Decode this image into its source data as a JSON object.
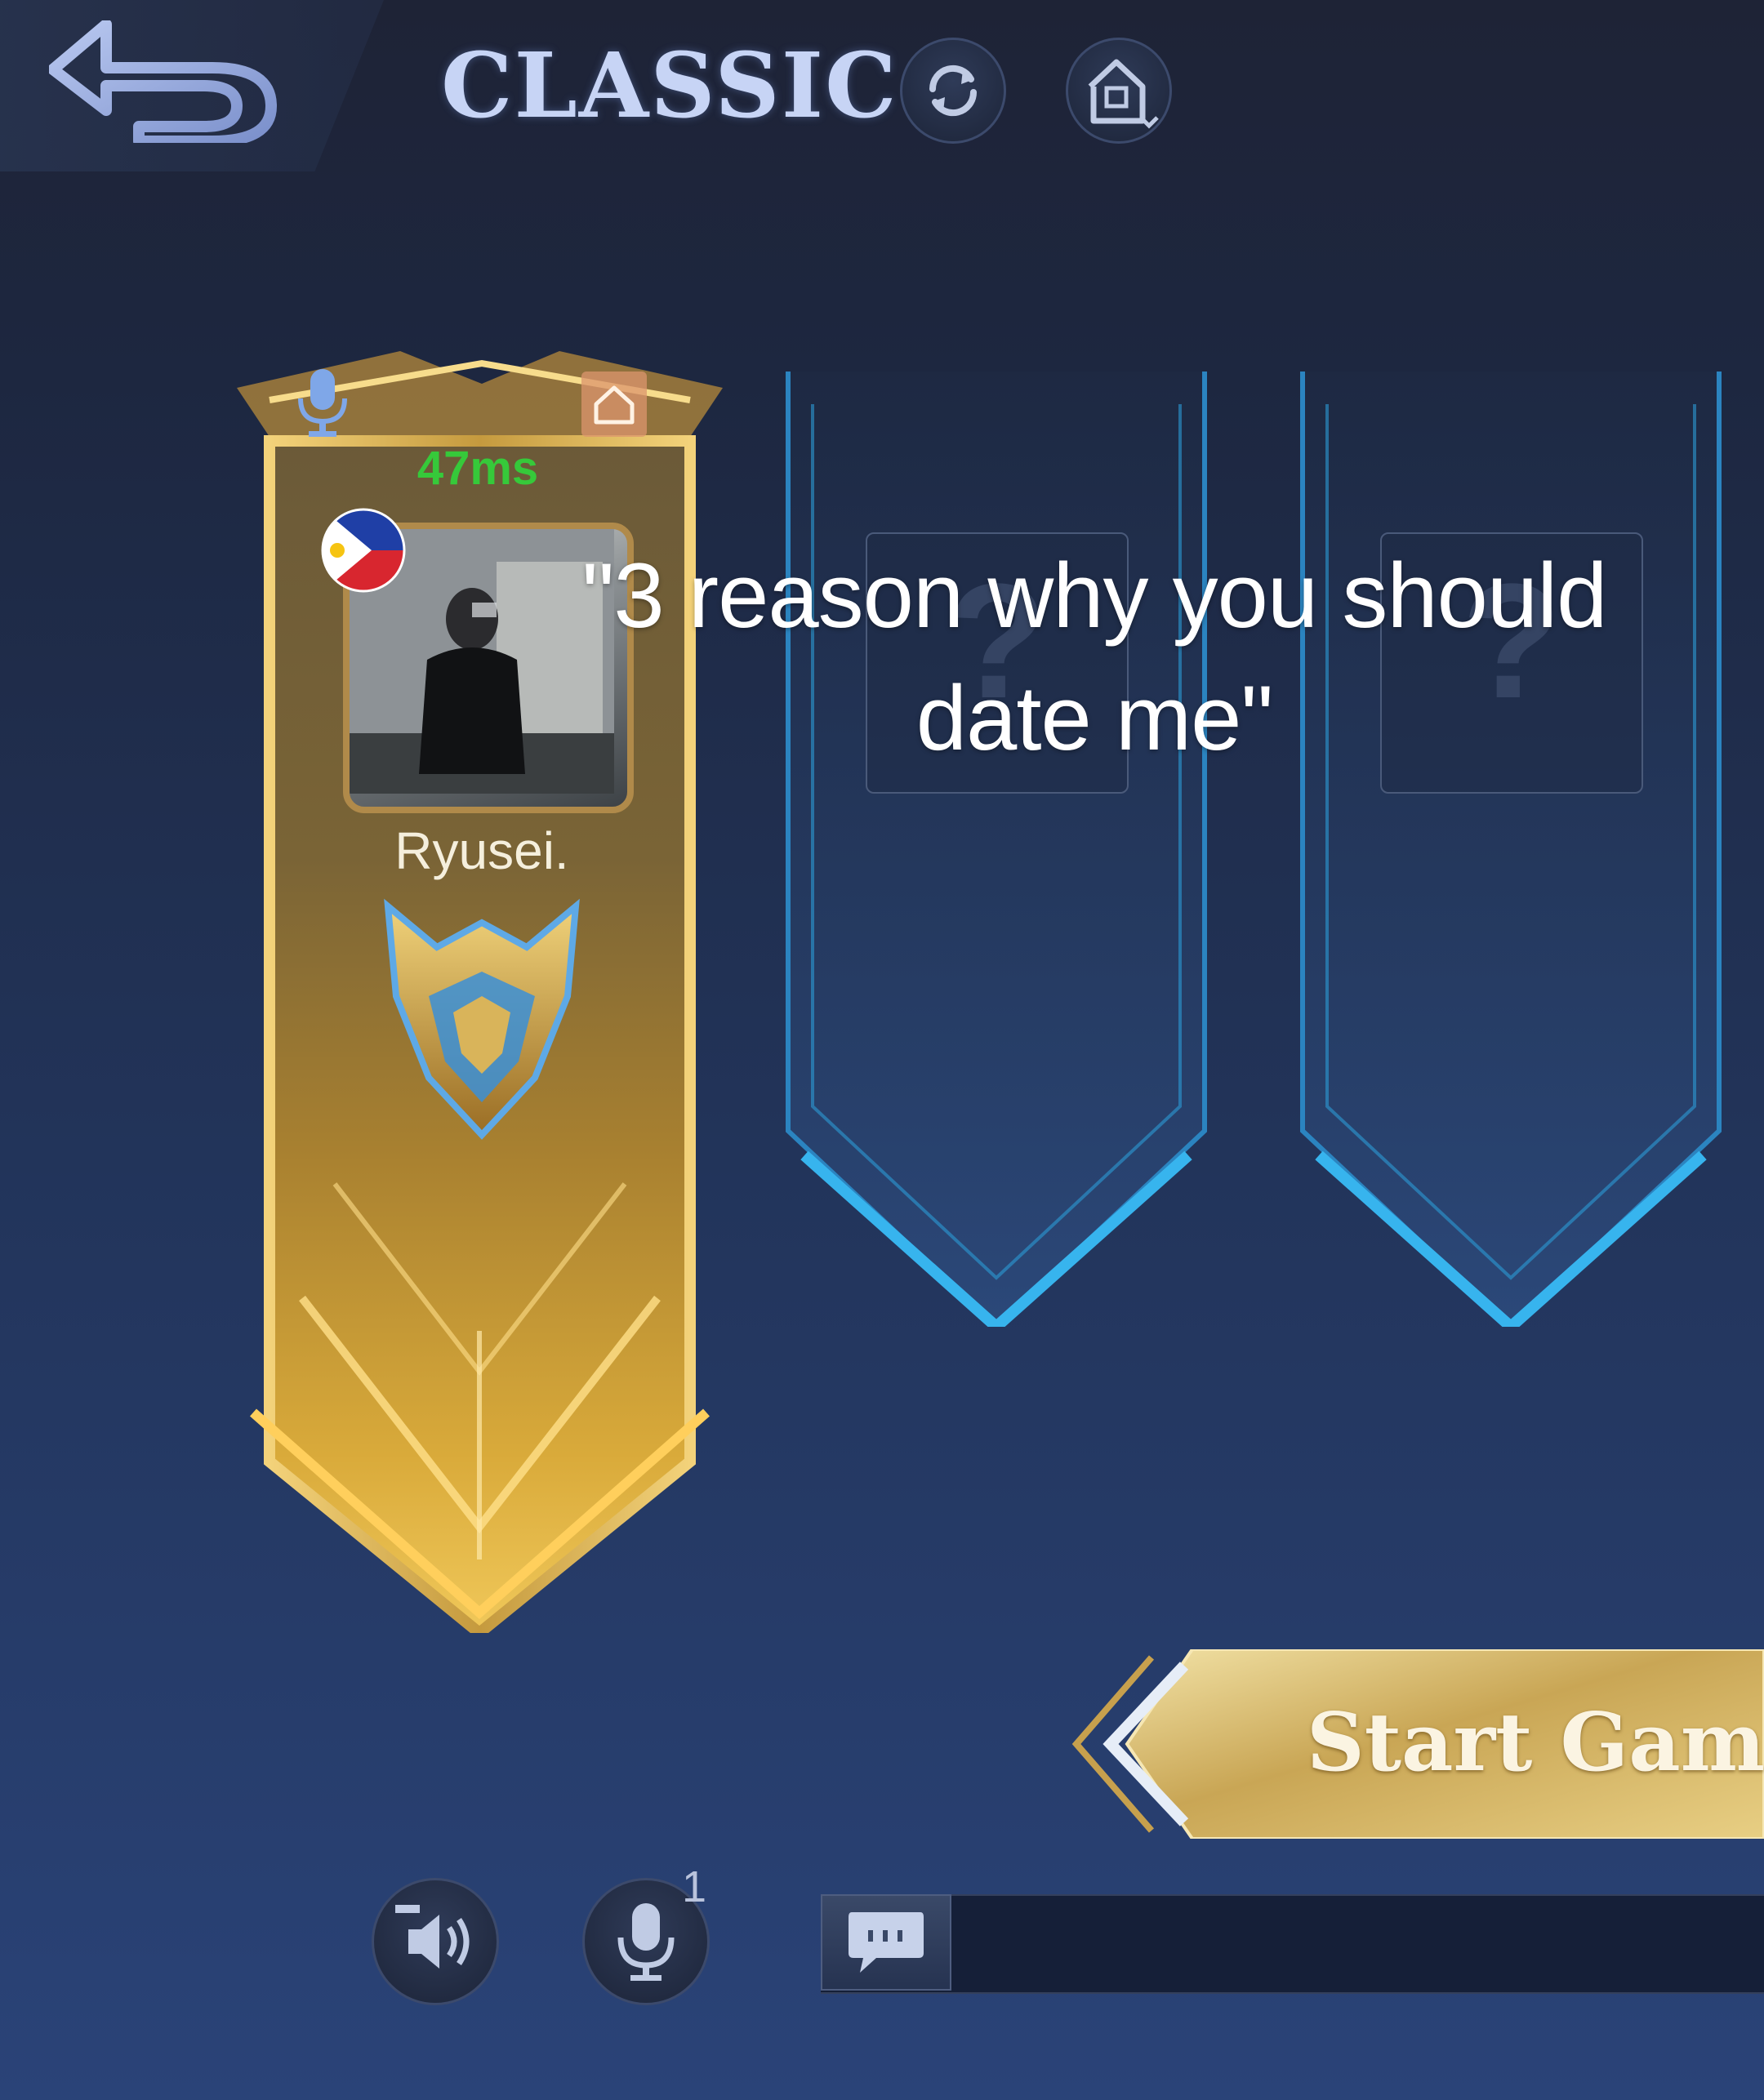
{
  "header": {
    "mode_title": "CLASSIC"
  },
  "player": {
    "ping": "47ms",
    "name": "Ryusei.",
    "country_flag": "philippines-flag-icon",
    "rank_emblem": "mythic-rank-emblem"
  },
  "slots": [
    {
      "state": "empty",
      "icon": "question-mark-icon"
    },
    {
      "state": "empty",
      "icon": "question-mark-icon"
    }
  ],
  "caption": {
    "line1": "\"3 reason why you should",
    "line2": "date me\""
  },
  "actions": {
    "start_label": "Start Game"
  },
  "bottom_bar": {
    "mic_badge": "1"
  },
  "colors": {
    "ping_green": "#36c93a",
    "gold": "#d9b45a",
    "slot_blue": "#2b9bd6",
    "background": "#22345a"
  }
}
